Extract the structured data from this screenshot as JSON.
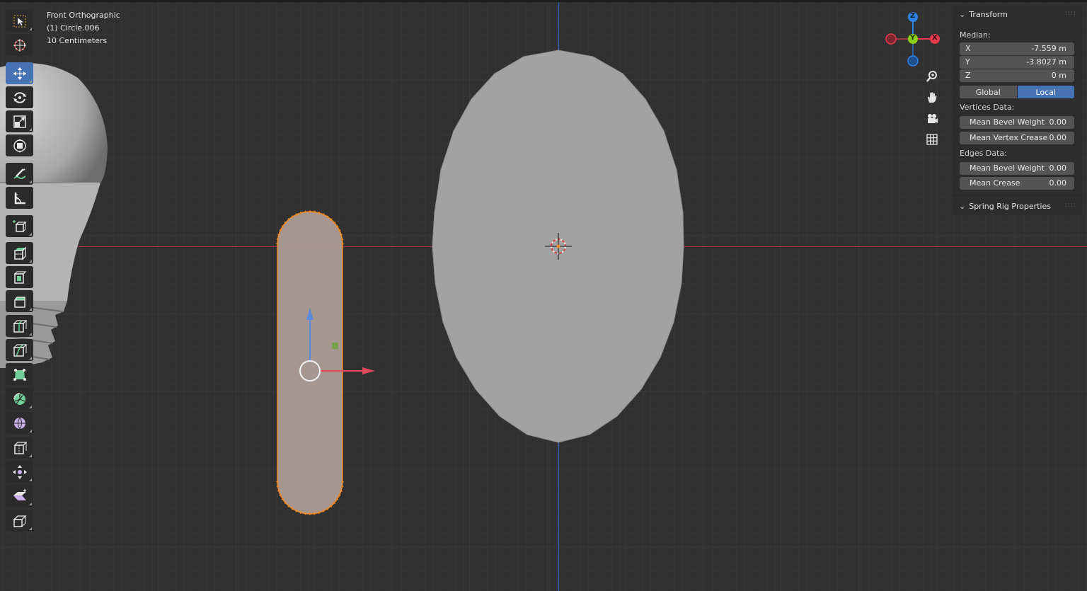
{
  "overlay": {
    "view_name": "Front Orthographic",
    "object_name": "(1) Circle.006",
    "grid_scale": "10 Centimeters"
  },
  "toolbar": {
    "tools": [
      {
        "id": "select-box",
        "icon": "select-box-icon",
        "active": false
      },
      {
        "id": "cursor",
        "icon": "cursor-icon",
        "active": false
      },
      {
        "id": "move",
        "icon": "move-icon",
        "active": true
      },
      {
        "id": "rotate",
        "icon": "rotate-icon",
        "active": false
      },
      {
        "id": "scale",
        "icon": "scale-icon",
        "active": false
      },
      {
        "id": "transform",
        "icon": "transform-icon",
        "active": false
      },
      {
        "id": "annotate",
        "icon": "annotate-icon",
        "active": false
      },
      {
        "id": "measure",
        "icon": "measure-icon",
        "active": false
      },
      {
        "id": "add-cube",
        "icon": "add-cube-icon",
        "active": false
      },
      {
        "id": "extrude",
        "icon": "extrude-icon",
        "active": false
      },
      {
        "id": "inset",
        "icon": "inset-icon",
        "active": false
      },
      {
        "id": "bevel",
        "icon": "bevel-icon",
        "active": false
      },
      {
        "id": "loop-cut",
        "icon": "loop-cut-icon",
        "active": false
      },
      {
        "id": "knife",
        "icon": "knife-icon",
        "active": false
      },
      {
        "id": "poly-build",
        "icon": "poly-build-icon",
        "active": false
      },
      {
        "id": "spin",
        "icon": "spin-icon",
        "active": false
      },
      {
        "id": "smooth",
        "icon": "smooth-icon",
        "active": false
      },
      {
        "id": "edge-slide",
        "icon": "edge-slide-icon",
        "active": false
      },
      {
        "id": "shrink-fatten",
        "icon": "shrink-fatten-icon",
        "active": false
      },
      {
        "id": "shear",
        "icon": "shear-icon",
        "active": false
      },
      {
        "id": "rip",
        "icon": "rip-icon",
        "active": false
      }
    ]
  },
  "gizmo": {
    "z_label": "Z",
    "y_label": "Y",
    "x_label": "X",
    "colors": {
      "x": "#e8394f",
      "y": "#8acf1b",
      "z": "#2f83e3"
    }
  },
  "transform_panel": {
    "title": "Transform",
    "median_label": "Median:",
    "x": {
      "label": "X",
      "value": "-7.559 m"
    },
    "y": {
      "label": "Y",
      "value": "-3.8027 m"
    },
    "z": {
      "label": "Z",
      "value": "0 m"
    },
    "space_global": "Global",
    "space_local": "Local",
    "vertices_label": "Vertices Data:",
    "vertex_bevel": {
      "label": "Mean Bevel Weight",
      "value": "0.00"
    },
    "vertex_crease": {
      "label": "Mean Vertex Crease",
      "value": "0.00"
    },
    "edges_label": "Edges Data:",
    "edge_bevel": {
      "label": "Mean Bevel Weight",
      "value": "0.00"
    },
    "edge_crease": {
      "label": "Mean Crease",
      "value": "0.00"
    }
  },
  "spring_panel": {
    "title": "Spring Rig Properties"
  },
  "colors": {
    "accent": "#4772b3",
    "selection_orange": "#f08a24",
    "axis_red": "#b5313d",
    "axis_blue": "#2b5ea9"
  }
}
